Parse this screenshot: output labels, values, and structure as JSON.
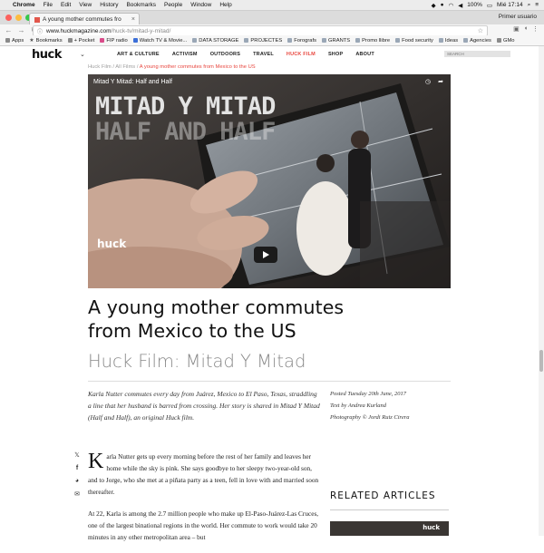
{
  "menubar": {
    "items": [
      "Chrome",
      "File",
      "Edit",
      "View",
      "History",
      "Bookmarks",
      "People",
      "Window",
      "Help"
    ],
    "battery": "100%",
    "clock": "Mié 17:14"
  },
  "browser": {
    "tab_title": "A young mother commutes fro",
    "profile": "Primer usuario",
    "url_host": "www.huckmagazine.com",
    "url_path": "/huck-tv/mitad-y-mitad/"
  },
  "bookmarks": [
    "Apps",
    "Bookmarks",
    "+ Pocket",
    "FIP radio",
    "Watch TV & Movie...",
    "DATA STORAGE",
    "PROJECTES",
    "Forografs",
    "GRANTS",
    "Promo llibre",
    "Food security",
    "Ideas",
    "Agencies",
    "GMo"
  ],
  "site": {
    "logo": "huck",
    "nav": [
      {
        "label": "ART & CULTURE",
        "active": false
      },
      {
        "label": "ACTIVISM",
        "active": false
      },
      {
        "label": "OUTDOORS",
        "active": false
      },
      {
        "label": "TRAVEL",
        "active": false
      },
      {
        "label": "HUCK FILM",
        "active": true
      },
      {
        "label": "SHOP",
        "active": false
      },
      {
        "label": "ABOUT",
        "active": false
      }
    ],
    "search_placeholder": "SEARCH"
  },
  "breadcrumb": {
    "first": "Huck Film",
    "second": "All Films",
    "current": "A young mother commutes from Mexico to the US"
  },
  "video": {
    "title": "Mitad Y Mitad: Half and Half",
    "overlay_line1": "MITAD Y MITAD",
    "overlay_line2": "HALF AND HALF",
    "watermark": "huck"
  },
  "article": {
    "headline_line1": "A young mother commutes",
    "headline_line2": "from Mexico to the US",
    "subhead": "Huck Film: Mitad Y Mitad",
    "standfirst": "Karla Nutter commutes every day from Juárez, Mexico to El Paso, Texas, straddling a line that her husband is barred from crossing. Her story is shared in Mitad Y Mitad (Half and Half), an original Huck film.",
    "posted": "Posted Tuesday 20th June, 2017",
    "text_by": "Text by Andrea Kurland",
    "photography": "Photography © Jordi Ruiz Cirera",
    "dropcap": "K",
    "para1_rest": "arla Nutter gets up every morning before the rest of her family and leaves her home while the sky is pink. She says goodbye to her sleepy two-year-old son, and to Jorge, who she met at a piñata party as a teen, fell in love with and married soon thereafter.",
    "para2": "At 22, Karla is among the 2.7 million people who make up El-Paso-Juárez-Las Cruces, one of the largest binational regions in the world. Her commute to work would take 20 minutes in any other metropolitan area – but"
  },
  "related": {
    "heading": "RELATED ARTICLES",
    "thumb_logo": "huck"
  },
  "colors": {
    "accent": "#e8473f"
  }
}
